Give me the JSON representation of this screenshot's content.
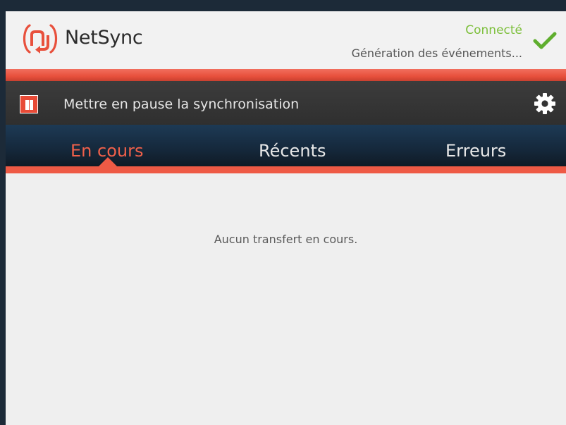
{
  "header": {
    "app_name": "NetSync",
    "status_label": "Connecté",
    "status_detail": "Génération des événements...",
    "logo_icon": "netsync-logo-icon",
    "status_icon": "check-icon"
  },
  "toolbar": {
    "pause_label": "Mettre en pause la synchronisation",
    "pause_icon": "pause-icon",
    "settings_icon": "gear-icon"
  },
  "tabs": [
    {
      "label": "En cours",
      "active": true
    },
    {
      "label": "Récents",
      "active": false
    },
    {
      "label": "Erreurs",
      "active": false
    }
  ],
  "content": {
    "empty_message": "Aucun transfert en cours."
  },
  "colors": {
    "accent": "#ee5a45",
    "connected": "#7cbf3a",
    "tabbar": "#15283b",
    "toolbar": "#333333"
  }
}
